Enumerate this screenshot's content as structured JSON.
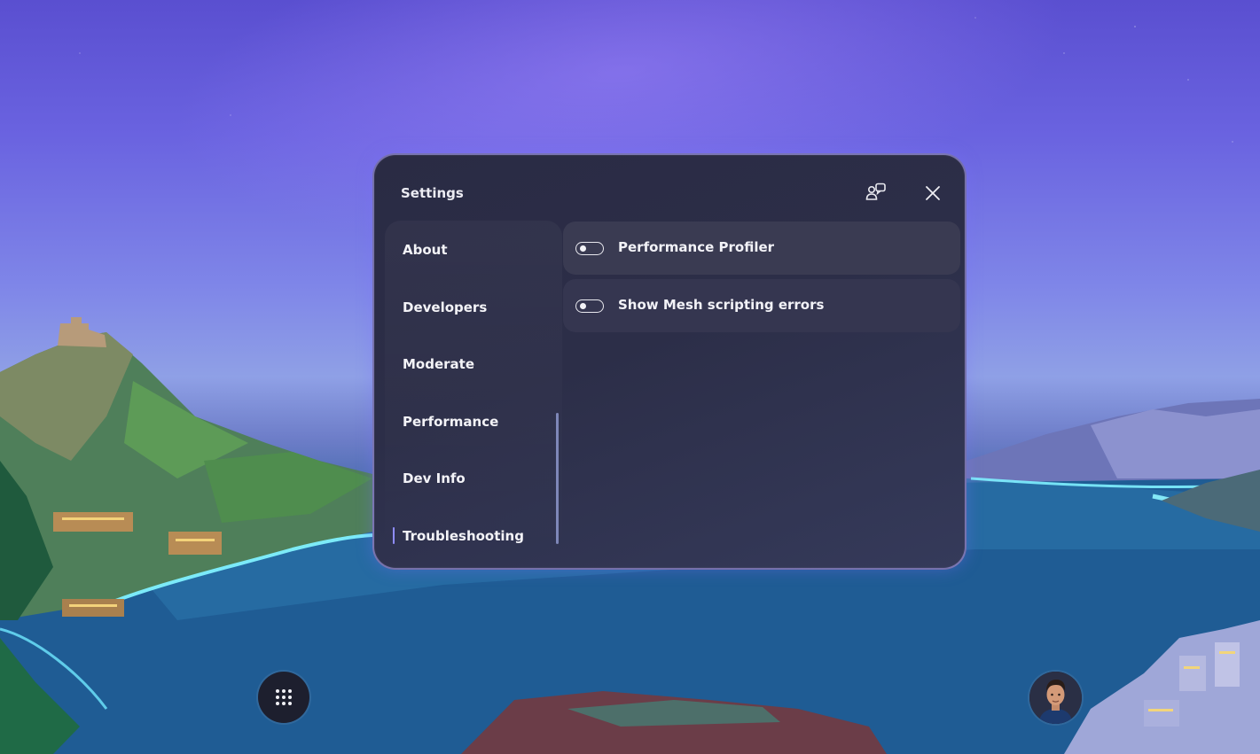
{
  "settings": {
    "title": "Settings",
    "feedback_icon": "feedback-icon",
    "close_icon": "close-icon"
  },
  "nav": {
    "items": [
      {
        "label": "About",
        "active": false
      },
      {
        "label": "Developers",
        "active": false
      },
      {
        "label": "Moderate",
        "active": false
      },
      {
        "label": "Performance",
        "active": false
      },
      {
        "label": "Dev Info",
        "active": false
      },
      {
        "label": "Troubleshooting",
        "active": true
      }
    ]
  },
  "options": [
    {
      "label": "Performance Profiler",
      "enabled": false
    },
    {
      "label": "Show Mesh scripting errors",
      "enabled": false
    }
  ],
  "bottom_bar": {
    "apps_icon": "grid-dots-icon",
    "avatar_icon": "avatar-icon"
  },
  "colors": {
    "accent": "#8f8cff",
    "panel": "#2c2e48",
    "row": "#3a3b52"
  }
}
